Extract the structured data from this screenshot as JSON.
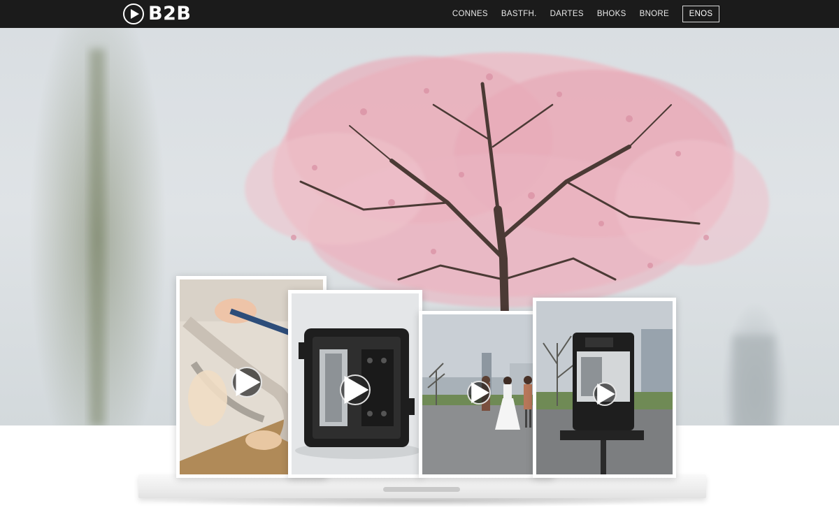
{
  "brand": {
    "name": "B2B",
    "logo_icon": "play-circle-icon"
  },
  "nav": {
    "links": [
      "CONNES",
      "BASTFH.",
      "DARTES",
      "BHOKS",
      "BNORE"
    ],
    "cta_label": "ENOS"
  },
  "hero": {
    "image": "cherry-blossom-tree"
  },
  "videos": [
    {
      "subject": "hand-with-glass-tool",
      "icon": "play-icon"
    },
    {
      "subject": "black-device-case",
      "icon": "play-icon"
    },
    {
      "subject": "people-in-plaza",
      "icon": "play-icon"
    },
    {
      "subject": "kiosk-machine-outdoors",
      "icon": "play-icon"
    }
  ],
  "colors": {
    "topbar": "#1b1b1b",
    "blossom": "#e8a6b5",
    "card_border": "#ffffff"
  }
}
